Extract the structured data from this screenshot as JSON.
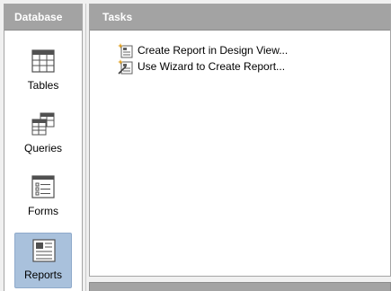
{
  "sidebar": {
    "title": "Database",
    "items": [
      {
        "label": "Tables",
        "icon": "table-icon",
        "selected": false
      },
      {
        "label": "Queries",
        "icon": "query-icon",
        "selected": false
      },
      {
        "label": "Forms",
        "icon": "form-icon",
        "selected": false
      },
      {
        "label": "Reports",
        "icon": "report-icon",
        "selected": true
      }
    ]
  },
  "main": {
    "title": "Tasks",
    "tasks": [
      {
        "label": "Create Report in Design View...",
        "icon": "report-design-icon"
      },
      {
        "label": "Use Wizard to Create Report...",
        "icon": "report-wizard-icon"
      }
    ]
  },
  "colors": {
    "header_bg": "#a3a3a3",
    "selected_bg": "#a9c1dc"
  }
}
